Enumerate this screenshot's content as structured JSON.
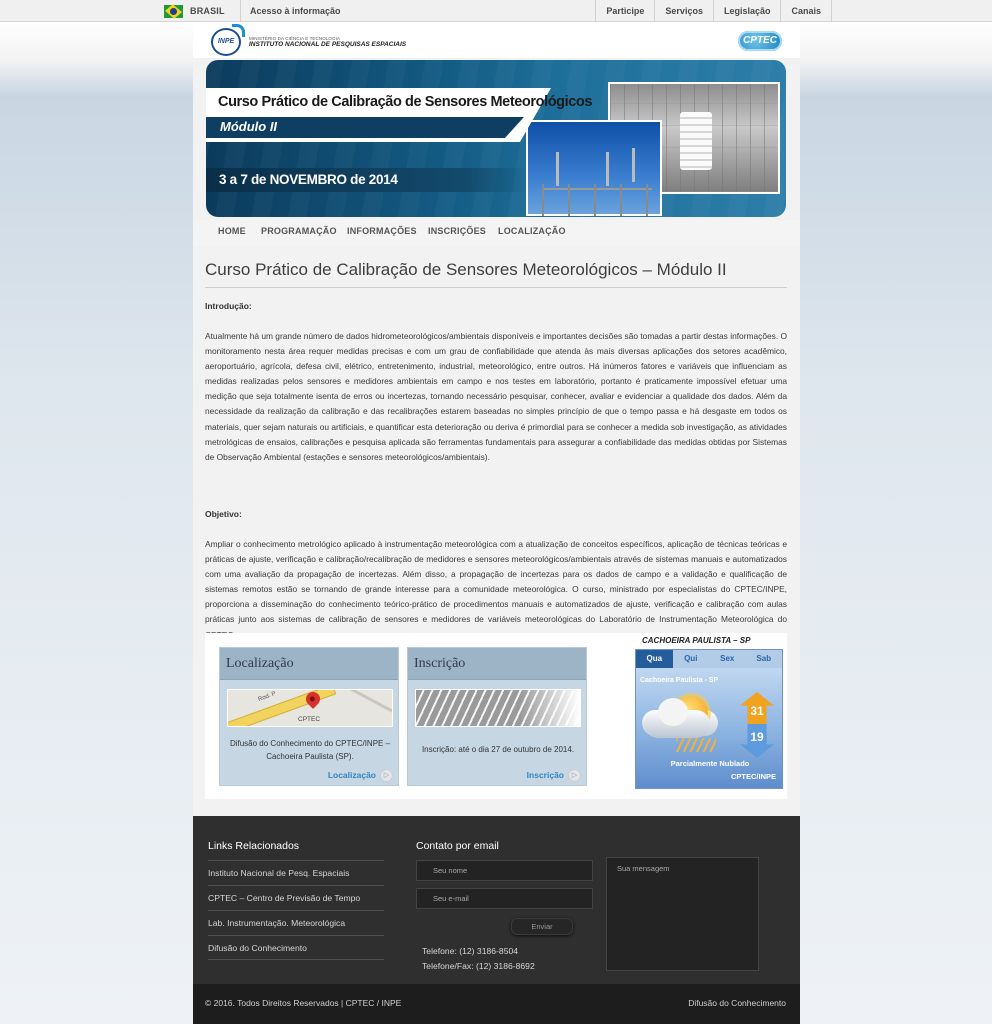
{
  "govbar": {
    "country": "BRASIL",
    "access": "Acesso à informação",
    "links": [
      "Participe",
      "Serviços",
      "Legislação",
      "Canais"
    ]
  },
  "header": {
    "inpe_small": "MINISTÉRIO DA CIÊNCIA E TECNOLOGIA",
    "inpe_name": "INSTITUTO NACIONAL DE PESQUISAS ESPACIAIS",
    "inpe_mark": "INPE",
    "cptec_logo": "CPTEC"
  },
  "banner": {
    "title": "Curso Prático de Calibração de Sensores Meteorológicos",
    "module": "Módulo II",
    "date": "3 a 7 de NOVEMBRO de 2014"
  },
  "nav": [
    "HOME",
    "PROGRAMAÇÃO",
    "INFORMAÇÕES",
    "INSCRIÇÕES",
    "LOCALIZAÇÃO"
  ],
  "content": {
    "title": "Curso Prático de Calibração de Sensores Meteorológicos – Módulo II",
    "intro_label": "Introdução:",
    "intro_text": "Atualmente há um grande número de dados hidrometeorológicos/ambientais disponíveis e importantes decisões são tomadas a partir destas informações. O monitoramento nesta área requer medidas precisas e com um grau de confiabilidade que atenda às mais diversas aplicações dos setores acadêmico, aeroportuário, agrícola, defesa civil, elétrico, entretenimento, industrial, meteorológico, entre outros. Há inúmeros fatores e variáveis que influenciam as medidas realizadas pelos sensores e medidores ambientais em campo e nos testes em laboratório, portanto é praticamente impossível efetuar uma medição que seja totalmente isenta de erros ou incertezas, tornando necessário pesquisar, conhecer, avaliar e evidenciar a qualidade dos dados. Além da necessidade da realização da calibração e das recalibrações estarem baseadas no simples princípio de que o tempo passa e há desgaste em todos os materiais, quer sejam naturais ou artificiais, e quantificar esta deterioração ou deriva é primordial para se conhecer a medida sob investigação, as atividades metrológicas de ensaios, calibrações e pesquisa aplicada são ferramentas fundamentais para assegurar a confiabilidade das medidas obtidas por Sistemas de Observação Ambiental (estações e sensores meteorológicos/ambientais).",
    "objective_label": "Objetivo:",
    "objective_text": "Ampliar o conhecimento metrológico aplicado à instrumentação meteorológica com a atualização de conceitos específicos, aplicação de técnicas teóricas e práticas de ajuste, verificação e calibração/recalibração de medidores e sensores meteorológicos/ambientais através de sistemas manuais e automatizados com uma avaliação da propagação de incertezas. Além disso, a propagação de incertezas para os dados de campo e a validação e qualificação de sistemas remotos estão se tornando de grande interesse para a comunidade meteorológica. O curso, ministrado por especialistas do CPTEC/INPE, proporciona a disseminação do conhecimento teórico-prático de procedimentos manuais e automatizados de ajuste, verificação e calibração com aulas práticas junto aos sistemas de calibração de sensores e medidores de variáveis meteorológicas do Laboratório de Instrumentação Meteorológica do CPTEC."
  },
  "widgets": {
    "location": {
      "title": "Localização",
      "map_road": "Rod. P",
      "map_label": "CPTEC",
      "text": "Difusão do Conhecimento do CPTEC/INPE – Cachoeira Paulista (SP).",
      "link": "Localização"
    },
    "registration": {
      "title": "Inscrição",
      "text": "Inscrição: até o dia 27 de outubro de 2014.",
      "link": "Inscrição"
    },
    "weather": {
      "city_heading": "CACHOEIRA PAULISTA – SP",
      "tabs": [
        "Qua",
        "Qui",
        "Sex",
        "Sab"
      ],
      "active_tab": 0,
      "place": "Cachoeira Paulista - SP",
      "max": "31",
      "min": "19",
      "condition": "Parcialmente Nublado",
      "brand": "CPTEC/INPE",
      "icon": "partly-cloudy-icon"
    }
  },
  "footer": {
    "links_heading": "Links Relacionados",
    "links": [
      "Instituto Nacional de Pesq. Espaciais",
      "CPTEC – Centro de Previsão de Tempo",
      "Lab. Instrumentação. Meteorológica",
      "Difusão do Conhecimento"
    ],
    "contact_heading": "Contato por email",
    "name_placeholder": "Seu nome",
    "email_placeholder": "Seu e-mail",
    "message_placeholder": "Sua mensagem",
    "send": "Enviar",
    "phone": "Telefone: (12) 3186-8504",
    "fax": "Telefone/Fax: (12) 3186-8692",
    "copyright": "© 2016. Todos Direitos Reservados | CPTEC / INPE",
    "right": "Difusão do Conhecimento"
  },
  "colors": {
    "footer_bg": "#2f2f2f",
    "link_blue": "#2f86c6",
    "box_header": "#9db3c6",
    "weather_tab_active": "#255c9c"
  }
}
